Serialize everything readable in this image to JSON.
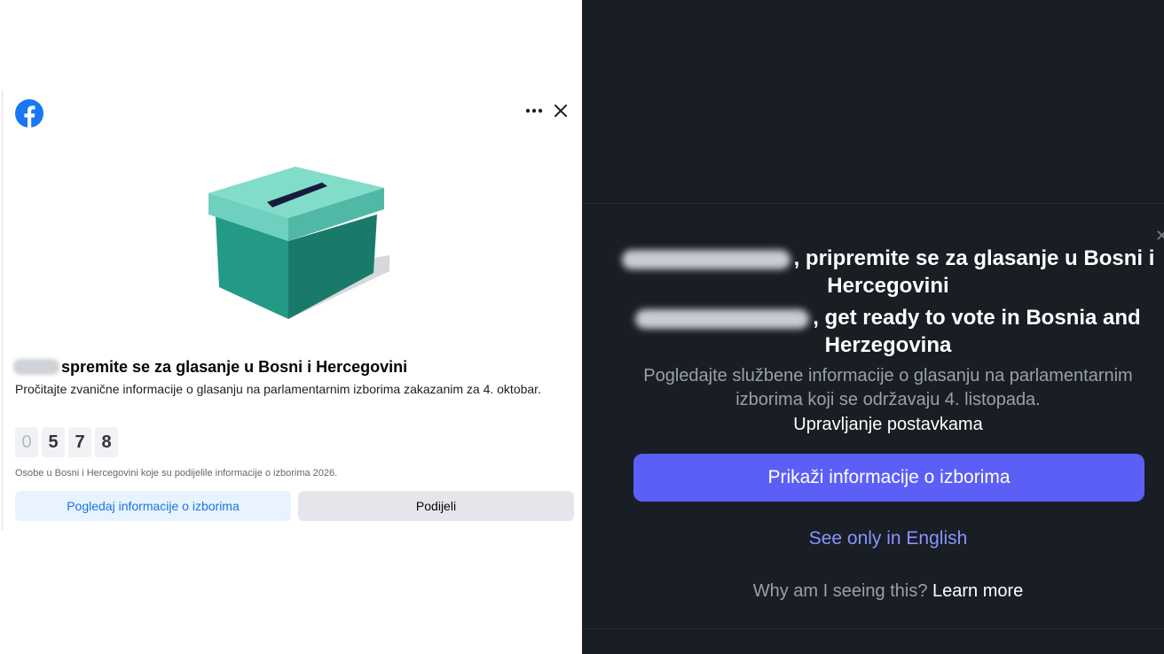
{
  "left": {
    "title": "spremite se za glasanje u Bosni i Hercegovini",
    "description": "Pročitajte zvanične informacije o glasanju na parlamentarnim izborima zakazanim za 4. oktobar.",
    "counter_digits": [
      "0",
      "5",
      "7",
      "8"
    ],
    "caption": "Osobe u Bosni i Hercegovini koje su podijelile informacije o izborima 2026.",
    "view_button": "Pogledaj informacije o izborima",
    "share_button": "Podijeli",
    "icons": [
      "facebook-logo",
      "more-icon",
      "close-icon",
      "ballot-box"
    ],
    "colors": {
      "facebook_blue": "#1877f2",
      "ballot_teal": "#28b59b"
    }
  },
  "right": {
    "heading_bs": ", pripremite se za glasanje u Bosni i Hercegovini",
    "heading_en": ", get ready to vote in Bosnia and Herzegovina",
    "description": "Pogledajte službene informacije o glasanju na parlamentarnim izborima koji se održavaju 4. listopada.",
    "manage_settings": "Upravljanje postavkama",
    "primary_button": "Prikaži informacije o izborima",
    "english_link": "See only in English",
    "why_text": "Why am I seeing this?",
    "learn_more": "Learn more",
    "colors": {
      "background": "#191d24",
      "button": "#5b5ff6",
      "link": "#8a94ff"
    }
  }
}
